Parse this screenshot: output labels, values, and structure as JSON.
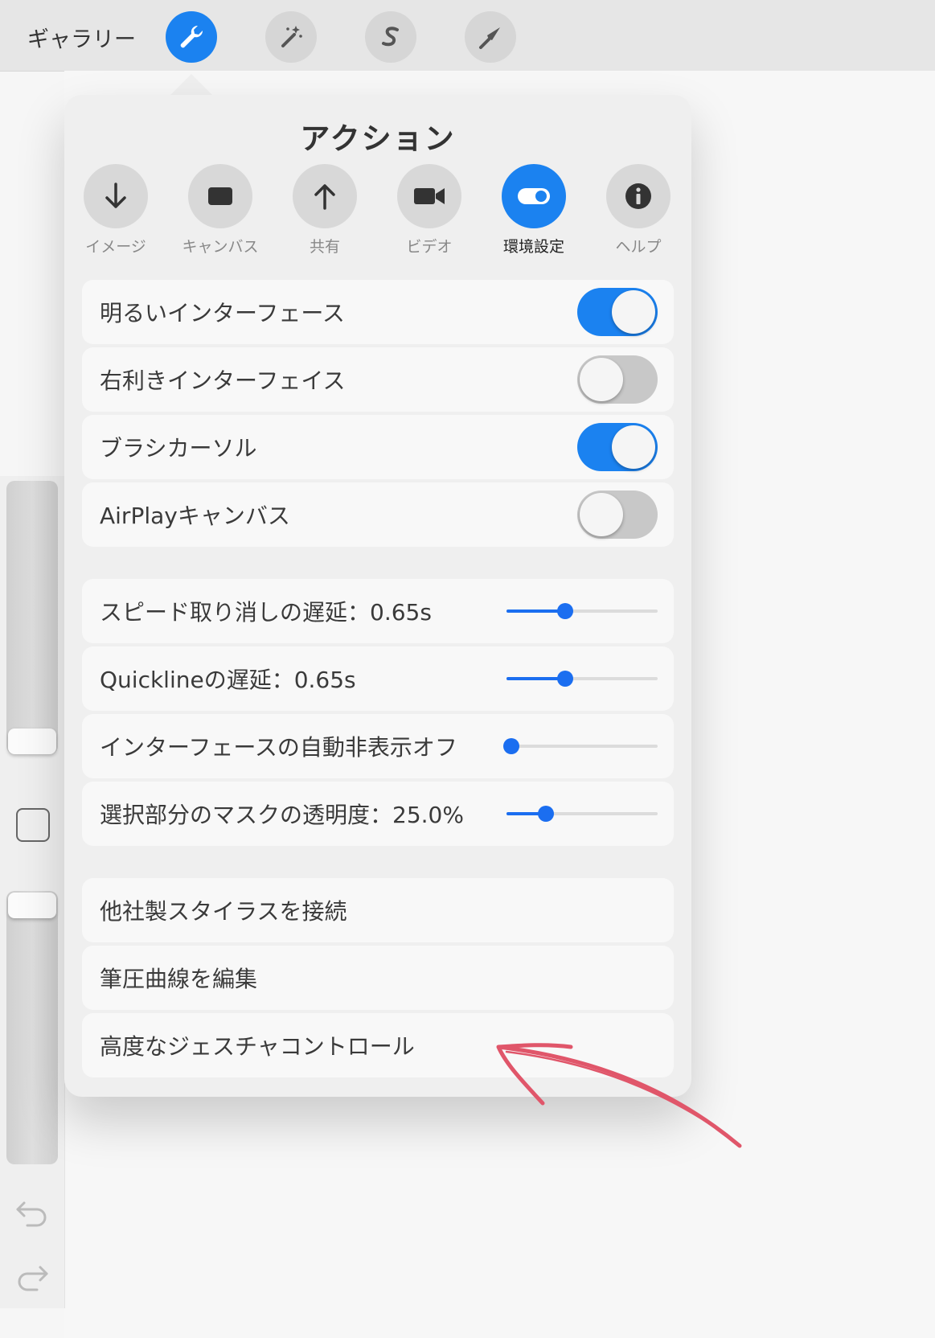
{
  "topbar": {
    "gallery_label": "ギャラリー",
    "tools": [
      {
        "name": "actions",
        "icon": "wrench-icon",
        "active": true
      },
      {
        "name": "adjustments",
        "icon": "magic-wand-icon",
        "active": false
      },
      {
        "name": "selection",
        "icon": "selection-s-icon",
        "active": false
      },
      {
        "name": "transform",
        "icon": "transform-arrow-icon",
        "active": false
      }
    ]
  },
  "popover": {
    "title": "アクション",
    "tabs": [
      {
        "label": "イメージ",
        "icon": "arrow-down-icon",
        "active": false
      },
      {
        "label": "キャンバス",
        "icon": "canvas-rect-icon",
        "active": false
      },
      {
        "label": "共有",
        "icon": "arrow-up-icon",
        "active": false
      },
      {
        "label": "ビデオ",
        "icon": "video-camera-icon",
        "active": false
      },
      {
        "label": "環境設定",
        "icon": "toggle-icon",
        "active": true
      },
      {
        "label": "ヘルプ",
        "icon": "info-icon",
        "active": false
      }
    ],
    "toggles": [
      {
        "label": "明るいインターフェース",
        "on": true
      },
      {
        "label": "右利きインターフェイス",
        "on": false
      },
      {
        "label": "ブラシカーソル",
        "on": true
      },
      {
        "label": "AirPlayキャンバス",
        "on": false
      }
    ],
    "sliders": [
      {
        "label": "スピード取り消しの遅延：0.65s",
        "value": 0.39
      },
      {
        "label": "Quicklineの遅延：0.65s",
        "value": 0.39
      },
      {
        "label": "インターフェースの自動非表示オフ",
        "value": 0.03
      },
      {
        "label": "選択部分のマスクの透明度：25.0%",
        "value": 0.26
      }
    ],
    "actions": [
      {
        "label": "他社製スタイラスを接続"
      },
      {
        "label": "筆圧曲線を編集"
      },
      {
        "label": "高度なジェスチャコントロール"
      }
    ]
  },
  "colors": {
    "accent": "#1b82f0",
    "annotation_arrow": "#e0566a"
  }
}
